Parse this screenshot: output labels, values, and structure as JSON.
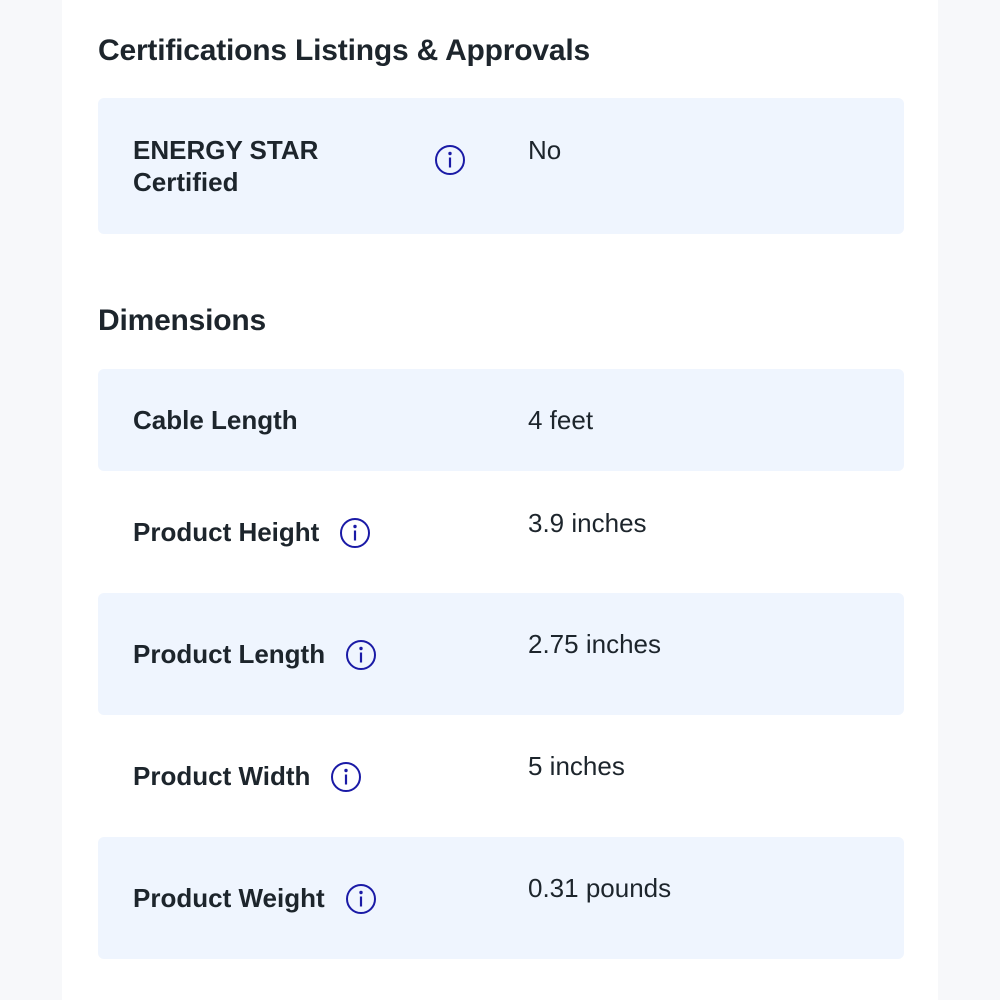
{
  "colors": {
    "accent": "#1a1aa6",
    "row_shade": "#eff5fe",
    "text": "#1d252c"
  },
  "certifications": {
    "title": "Certifications Listings & Approvals",
    "rows": [
      {
        "label_line1": "ENERGY STAR",
        "label_line2": "Certified",
        "value": "No",
        "icon": "info-icon"
      }
    ]
  },
  "dimensions": {
    "title": "Dimensions",
    "rows": [
      {
        "label": "Cable Length",
        "value": "4 feet"
      },
      {
        "label": "Product Height",
        "value": "3.9 inches",
        "icon": "info-icon"
      },
      {
        "label": "Product Length",
        "value": "2.75 inches",
        "icon": "info-icon"
      },
      {
        "label": "Product Width",
        "value": "5 inches",
        "icon": "info-icon"
      },
      {
        "label": "Product Weight",
        "value": "0.31 pounds",
        "icon": "info-icon"
      }
    ]
  }
}
